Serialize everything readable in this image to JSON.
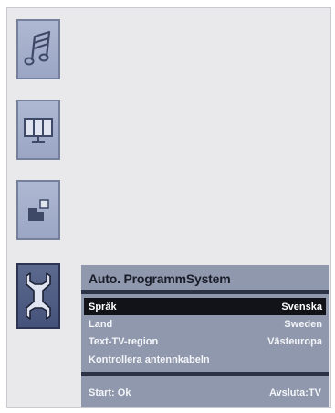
{
  "sidebar": {
    "icons": [
      {
        "name": "music-note-icon",
        "active": false
      },
      {
        "name": "picture-icon",
        "active": false
      },
      {
        "name": "setup-blocks-icon",
        "active": false
      },
      {
        "name": "wrench-icon",
        "active": true
      }
    ]
  },
  "menu": {
    "title": "Auto. ProgrammSystem",
    "rows": [
      {
        "label": "Språk",
        "value": "Svenska"
      },
      {
        "label": "Land",
        "value": "Sweden"
      },
      {
        "label": "Text-TV-region",
        "value": "Västeuropa"
      },
      {
        "label": "Kontrollera antennkabeln",
        "value": ""
      }
    ],
    "footer_left": "Start: Ok",
    "footer_right": "Avsluta:TV"
  },
  "colors": {
    "panel": "#8f98ad",
    "selected_row": "#111318",
    "icon_active": "#45527a",
    "icon_inactive": "#9aa6c4"
  }
}
